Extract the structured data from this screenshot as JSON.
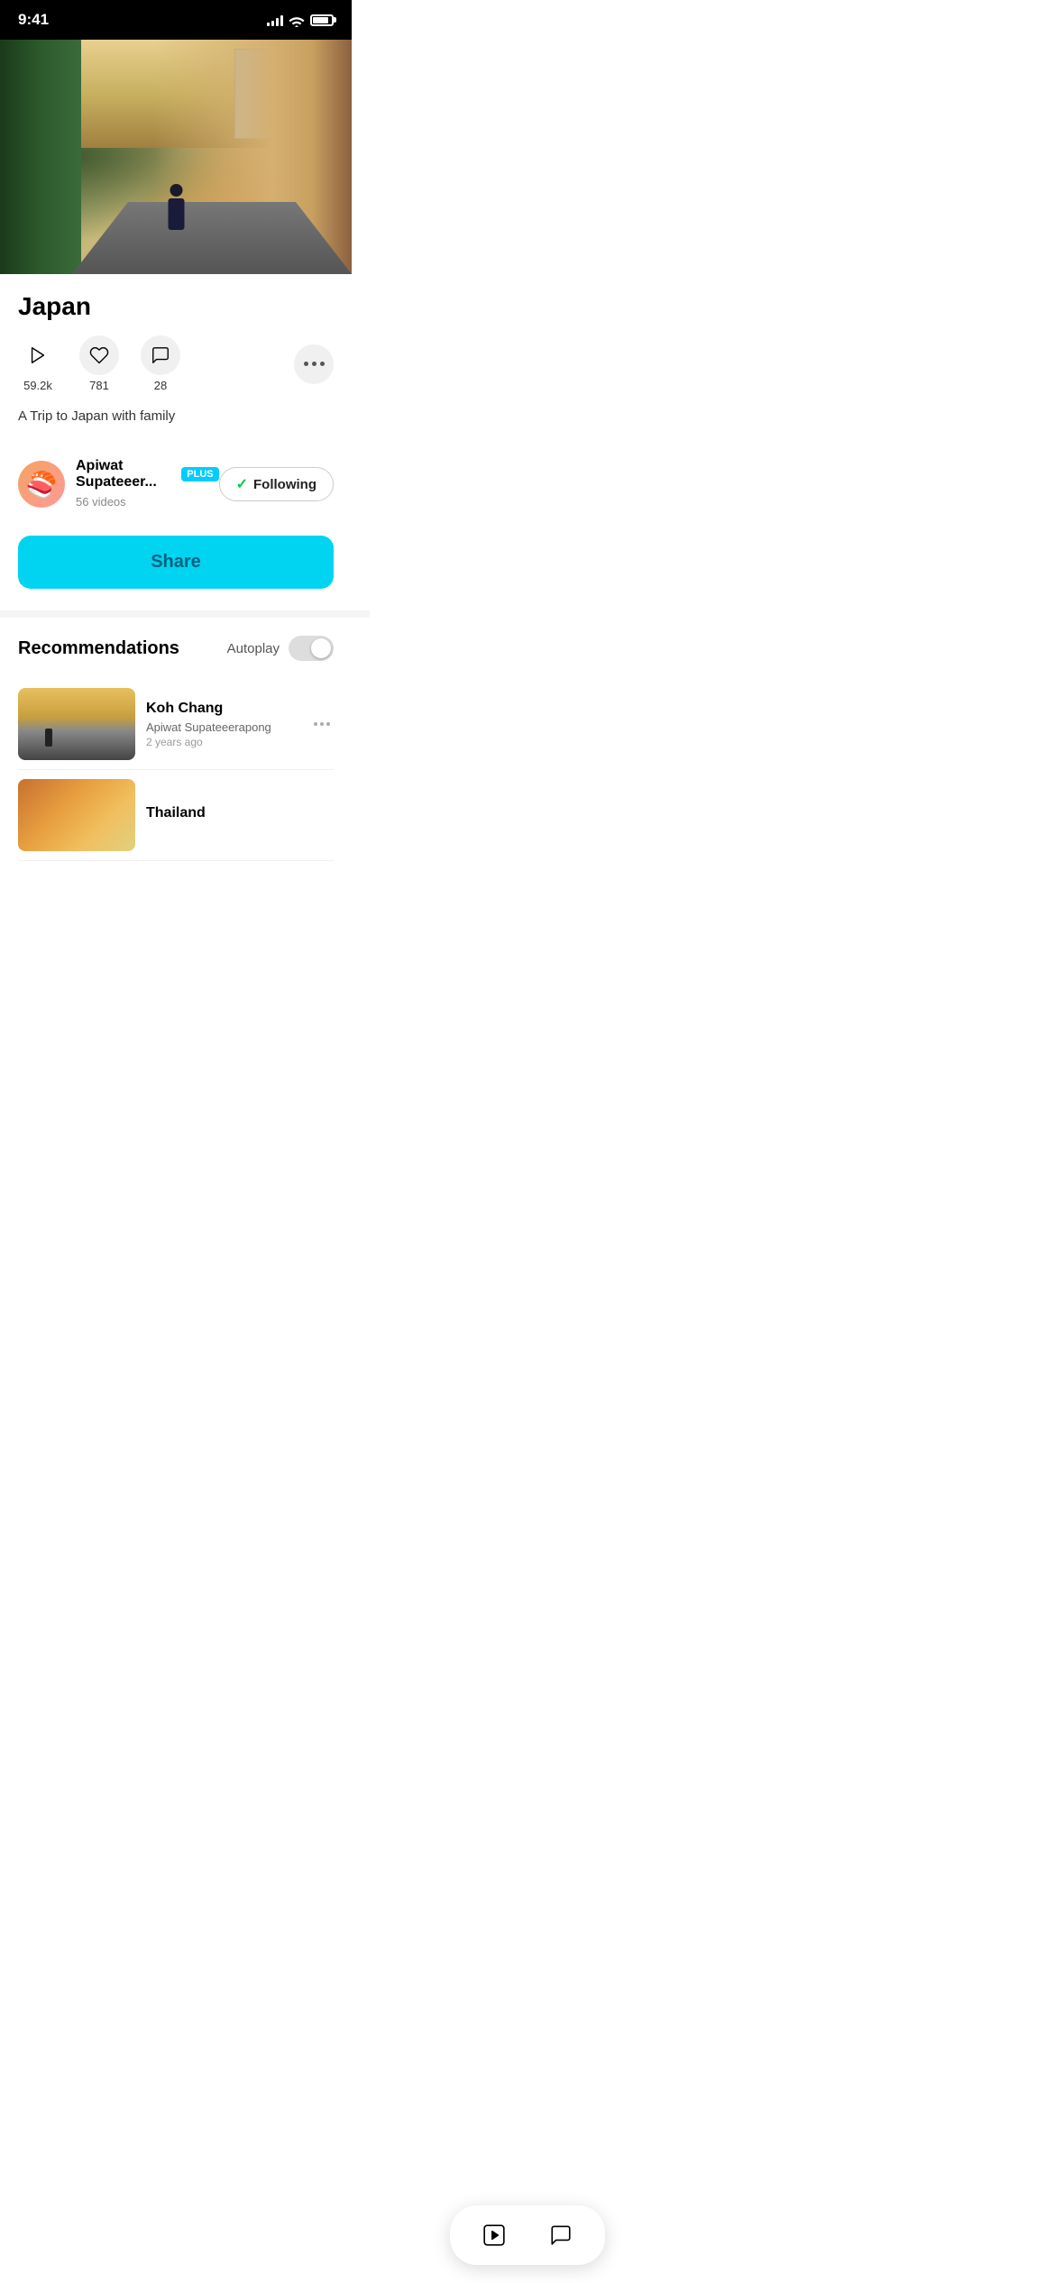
{
  "status_bar": {
    "time": "9:41",
    "signal_strength": 4,
    "wifi": true,
    "battery": 85
  },
  "hero": {
    "alt": "Japan street scene"
  },
  "video": {
    "title": "Japan",
    "stats": {
      "plays": "59.2k",
      "likes": "781",
      "comments": "28"
    },
    "description": "A Trip to Japan with family"
  },
  "creator": {
    "name": "Apiwat Supateeer...",
    "badge": "PLUS",
    "videos_count": "56 videos",
    "following": true,
    "following_label": "Following"
  },
  "share_button": {
    "label": "Share"
  },
  "recommendations": {
    "title": "Recommendations",
    "autoplay_label": "Autoplay",
    "autoplay_on": false,
    "items": [
      {
        "title": "Koh Chang",
        "creator": "Apiwat Supateeerapong",
        "time": "2 years ago",
        "thumb_type": "koh-chang"
      },
      {
        "title": "Thailand",
        "creator": "",
        "time": "",
        "thumb_type": "thailand"
      }
    ]
  },
  "bottom_nav": {
    "play_label": "play",
    "comment_label": "comment"
  },
  "icons": {
    "play": "▷",
    "heart": "♡",
    "comment": "💬",
    "more": "•••",
    "check": "✓"
  }
}
